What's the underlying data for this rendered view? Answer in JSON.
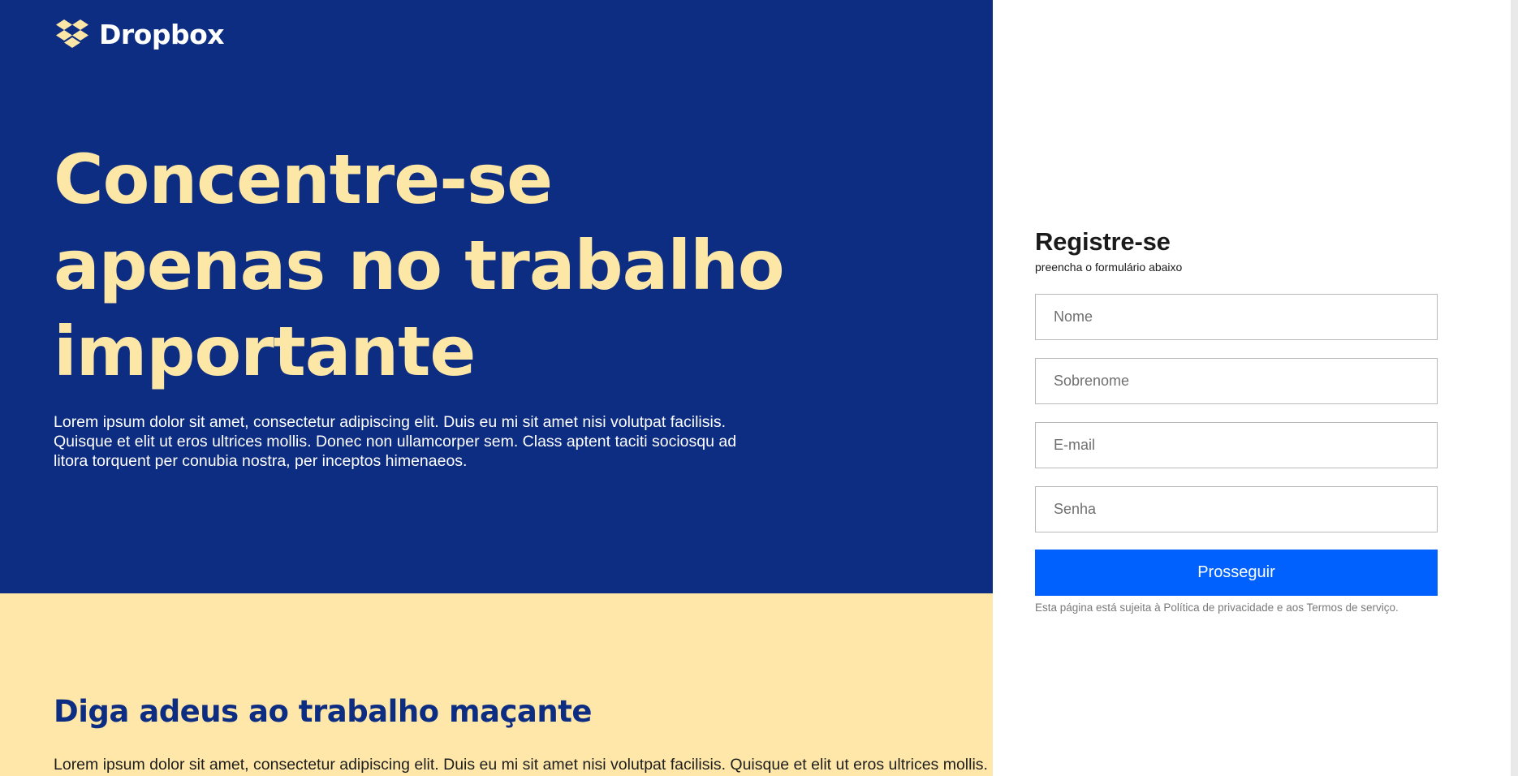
{
  "brand": {
    "name": "Dropbox",
    "icon": "dropbox-logo-icon",
    "logo_color": "#fde7a6"
  },
  "hero": {
    "title": "Concentre-se apenas no trabalho importante",
    "body": "Lorem ipsum dolor sit amet, consectetur adipiscing elit. Duis eu mi sit amet nisi volutpat facilisis. Quisque et elit ut eros ultrices mollis. Donec non ullamcorper sem. Class aptent taciti sociosqu ad litora torquent per conubia nostra, per inceptos himenaeos.",
    "bg_color": "#0d2d82",
    "title_color": "#fde7a6"
  },
  "section2": {
    "title": "Diga adeus ao trabalho maçante",
    "body": "Lorem ipsum dolor sit amet, consectetur adipiscing elit. Duis eu mi sit amet nisi volutpat facilisis. Quisque et elit ut eros ultrices mollis.",
    "bg_color": "#fee7a8"
  },
  "register": {
    "title": "Registre-se",
    "subtitle": "preencha o formulário abaixo",
    "fields": {
      "first_name": {
        "placeholder": "Nome",
        "value": ""
      },
      "last_name": {
        "placeholder": "Sobrenome",
        "value": ""
      },
      "email": {
        "placeholder": "E-mail",
        "value": ""
      },
      "password": {
        "placeholder": "Senha",
        "value": ""
      }
    },
    "submit_label": "Prosseguir",
    "submit_color": "#0061fe",
    "legal": "Esta página está sujeita à Política de privacidade e aos Termos de serviço."
  }
}
